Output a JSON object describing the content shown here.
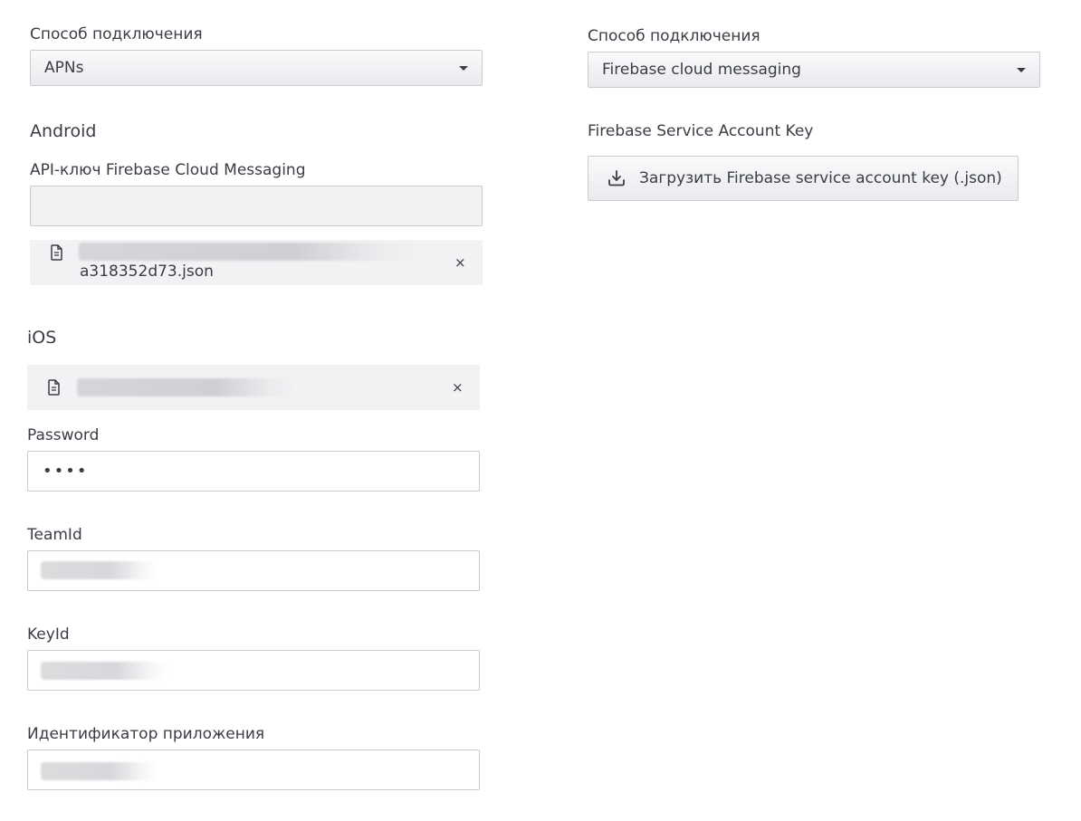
{
  "left": {
    "connection_label": "Способ подключения",
    "connection_value": "APNs",
    "android_heading": "Android",
    "fcm_key_label": "API-ключ Firebase Cloud Messaging",
    "fcm_key_value": "",
    "android_file_name": "a318352d73.json",
    "android_file_remove": "×",
    "ios_heading": "iOS",
    "ios_file_remove": "×",
    "password_label": "Password",
    "password_value": "••••",
    "teamid_label": "TeamId",
    "keyid_label": "KeyId",
    "app_id_label": "Идентификатор приложения"
  },
  "right": {
    "connection_label": "Способ подключения",
    "connection_value": "Firebase cloud messaging",
    "service_key_label": "Firebase Service Account Key",
    "upload_button_label": "Загрузить Firebase service account key (.json)"
  },
  "icons": {
    "file": "file-icon",
    "download": "download-icon",
    "caret": "chevron-down-icon"
  }
}
